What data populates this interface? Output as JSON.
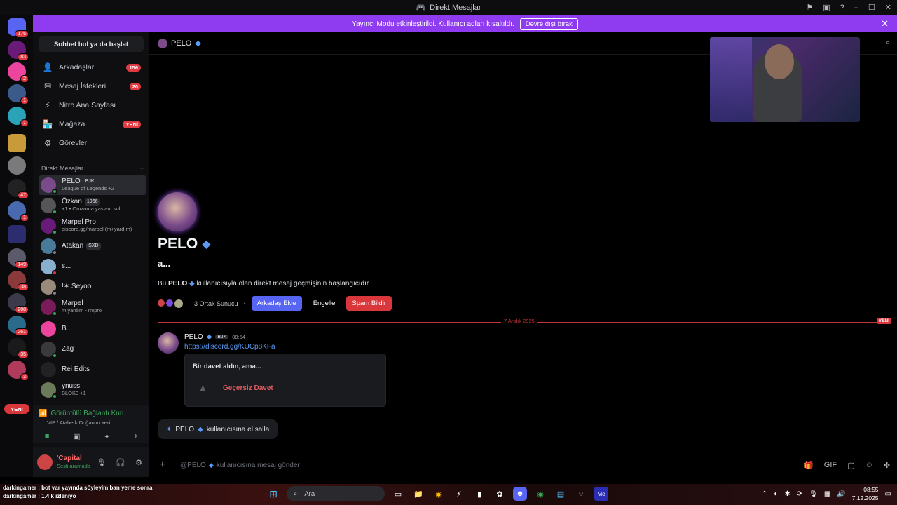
{
  "window": {
    "title": "Direkt Mesajlar"
  },
  "banner": {
    "text": "Yayıncı Modu etkinleştirildi. Kullanıcı adları kısaltıldı.",
    "button": "Devre dışı bırak"
  },
  "guild_badges": [
    "176",
    "83",
    "2",
    "1",
    "1",
    "2",
    "47",
    "1",
    "149",
    "38",
    "208",
    "261",
    "35",
    "3"
  ],
  "guild_new_pill": "YENİ",
  "sidebar": {
    "search": "Sohbet bul ya da başlat",
    "nav": [
      {
        "label": "Arkadaşlar",
        "count": "156",
        "icon": "friends-icon"
      },
      {
        "label": "Mesaj İstekleri",
        "count": "20",
        "icon": "mail-icon"
      },
      {
        "label": "Nitro Ana Sayfası",
        "count": "",
        "icon": "nitro-icon"
      },
      {
        "label": "Mağaza",
        "count": "YENİ",
        "icon": "shop-icon"
      },
      {
        "label": "Görevler",
        "count": "",
        "icon": "quests-icon"
      }
    ],
    "dm_header": "Direkt Mesajlar",
    "dms": [
      {
        "name": "PELO",
        "tag": "BJK",
        "sub": "League of Legends +2"
      },
      {
        "name": "Özkan",
        "tag": "1966",
        "sub": "+1 • Omzuma yaslan, sol ..."
      },
      {
        "name": "Marpel Pro",
        "tag": "",
        "sub": "discord.gg/marpel (m+yardım)"
      },
      {
        "name": "Atakan",
        "tag": "SXD",
        "sub": ""
      },
      {
        "name": "s...",
        "tag": "",
        "sub": ""
      },
      {
        "name": "!✶ Seyoo",
        "tag": "",
        "sub": ""
      },
      {
        "name": "Marpel",
        "tag": "",
        "sub": "m!yardım - m!pro"
      },
      {
        "name": "B...",
        "tag": "",
        "sub": ""
      },
      {
        "name": "Zag",
        "tag": "",
        "sub": ""
      },
      {
        "name": "Rei Edits",
        "tag": "",
        "sub": ""
      },
      {
        "name": "ynuss",
        "tag": "",
        "sub": "BLOK3 +1"
      }
    ],
    "voice": {
      "title": "Görüntülü Bağlantı Kuru",
      "channel": "VIP / Ataberk Doğan'ın Yeri"
    },
    "user": {
      "name": "'Capital",
      "status": "Sesli aramada"
    }
  },
  "main": {
    "top_name": "PELO",
    "profile": {
      "name": "PELO",
      "username": "a...",
      "intro_prefix": "Bu",
      "intro_name": "PELO",
      "intro_suffix": "kullanıcısıyla olan direkt mesaj geçmişinin başlangıcıdır.",
      "mutual": "3 Ortak Sunucu",
      "add_friend": "Arkadaş Ekle",
      "block": "Engelle",
      "report": "Spam Bildir"
    },
    "divider_date": "7 Aralık 2025",
    "divider_new": "YENİ",
    "message": {
      "author": "PELO",
      "tag": "BJK",
      "time": "08:54",
      "link": "https://discord.gg/KUCp8KFa",
      "invite_header": "Bir davet aldın, ama...",
      "invite_status": "Geçersiz Davet"
    },
    "wave": {
      "name": "PELO",
      "text": "kullanıcısına el salla"
    },
    "composer": {
      "mention": "@PELO",
      "placeholder": "kullanıcısına mesaj gönder"
    }
  },
  "stream_overlay": {
    "line1": "darkingamer : bot var yayında söyleyim ban yeme sonra",
    "line2": "darkingamer : 1.4 k izleniyo"
  },
  "taskbar": {
    "search": "Ara",
    "time": "08:55",
    "date": "7.12.2025"
  }
}
